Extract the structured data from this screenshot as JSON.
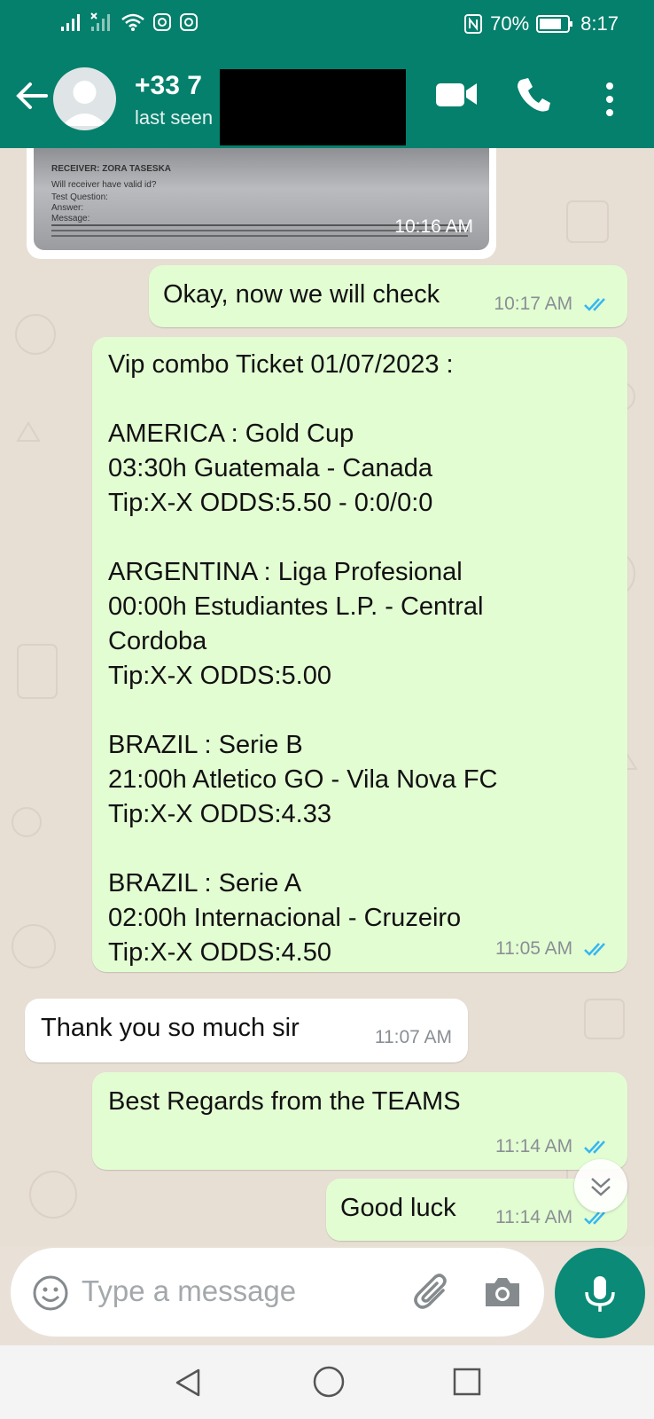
{
  "status_bar": {
    "battery": "70%",
    "time": "8:17"
  },
  "header": {
    "contact_name": "+33 7",
    "contact_status": "last seen"
  },
  "chat": {
    "image_message": {
      "time": "10:16 AM",
      "photo_lines": [
        "RECEIVER:       ZORA TASESKA",
        "Will receiver have valid id?",
        "Test Question:",
        "Answer:",
        "Message:"
      ]
    },
    "messages": [
      {
        "direction": "out",
        "text": "Okay, now we will check",
        "time": "10:17 AM"
      },
      {
        "direction": "out",
        "text": "Vip combo Ticket 01/07/2023 :\n\nAMERICA : Gold Cup\n03:30h Guatemala - Canada\nTip:X-X  ODDS:5.50  -  0:0/0:0\n\nARGENTINA : Liga Profesional\n00:00h Estudiantes L.P. - Central\nCordoba\nTip:X-X  ODDS:5.00\n\nBRAZIL : Serie B\n21:00h Atletico GO - Vila Nova FC\nTip:X-X  ODDS:4.33\n\nBRAZIL : Serie A\n02:00h Internacional - Cruzeiro\nTip:X-X  ODDS:4.50",
        "time": "11:05 AM"
      },
      {
        "direction": "in",
        "text": "Thank you so much sir",
        "time": "11:07 AM"
      },
      {
        "direction": "out",
        "text": "Best Regards from the TEAMS",
        "time": "11:14 AM"
      },
      {
        "direction": "out",
        "text": "Good luck",
        "time": "11:14 AM"
      }
    ]
  },
  "composer": {
    "placeholder": "Type a message"
  },
  "colors": {
    "brand": "#04806c",
    "outgoing_bubble": "#e3fdd3",
    "incoming_bubble": "#ffffff",
    "read_ticks": "#34b7f1"
  }
}
